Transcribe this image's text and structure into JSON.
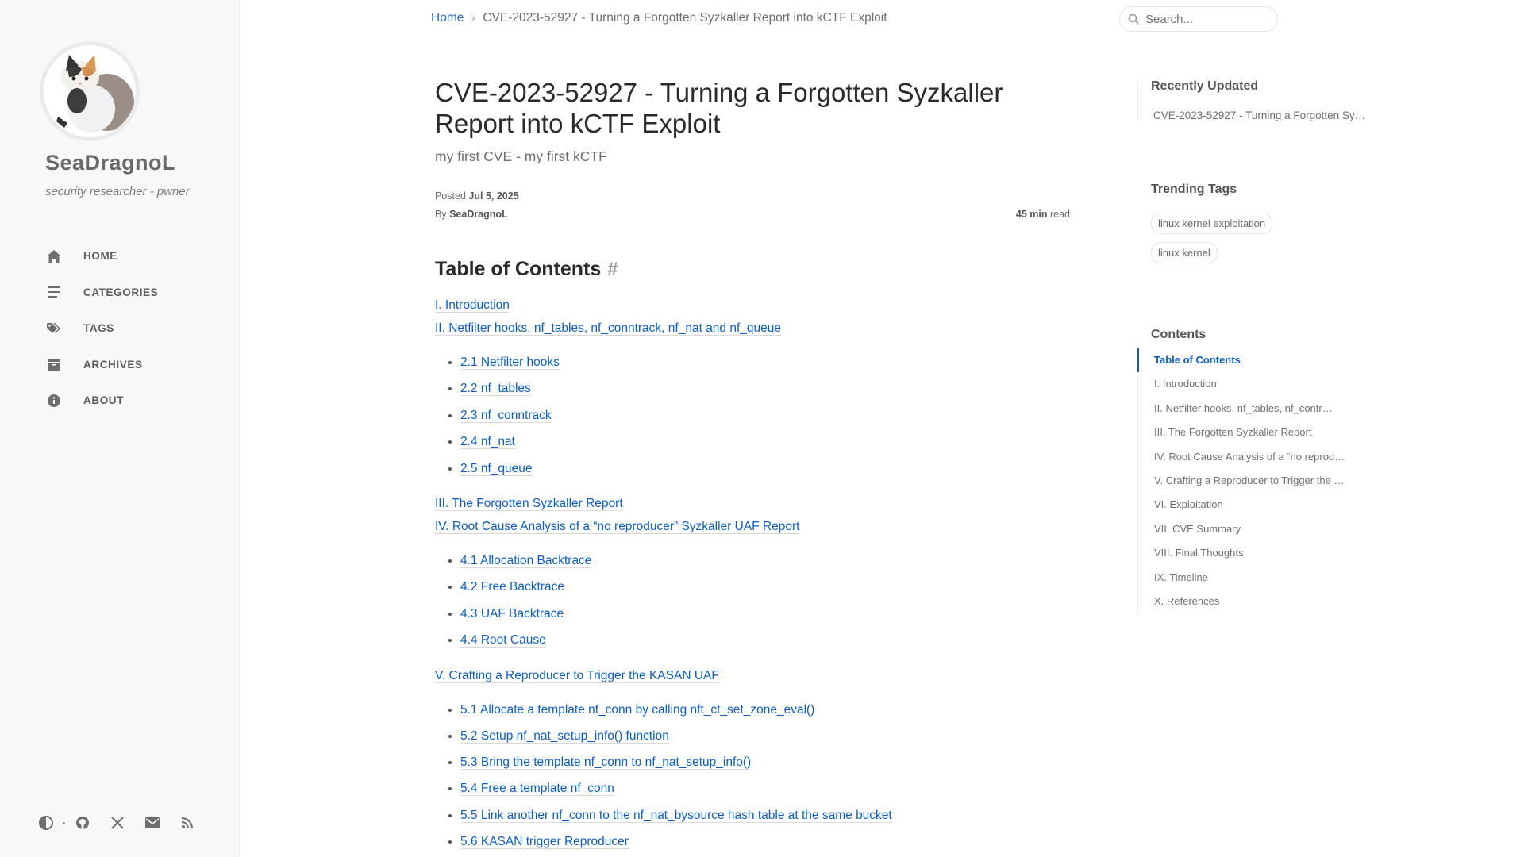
{
  "sidebar": {
    "site_title": "SeaDragnoL",
    "site_subtitle": "security researcher - pwner",
    "nav": [
      {
        "label": "HOME",
        "icon": "home-icon"
      },
      {
        "label": "CATEGORIES",
        "icon": "list-icon"
      },
      {
        "label": "TAGS",
        "icon": "tags-icon"
      },
      {
        "label": "ARCHIVES",
        "icon": "archive-icon"
      },
      {
        "label": "ABOUT",
        "icon": "info-icon"
      }
    ],
    "bottom_icons": [
      "theme-toggle-icon",
      "github-icon",
      "x-twitter-icon",
      "email-icon",
      "rss-icon"
    ]
  },
  "topbar": {
    "breadcrumb_home": "Home",
    "breadcrumb_current": "CVE-2023-52927 - Turning a Forgotten Syzkaller Report into kCTF Exploit",
    "search_placeholder": "Search..."
  },
  "post": {
    "title": "CVE-2023-52927 - Turning a Forgotten Syzkaller Report into kCTF Exploit",
    "subtitle": "my first CVE - my first kCTF",
    "posted_label": "Posted",
    "posted_date": "Jul 5, 2025",
    "by_label": "By",
    "author": "SeaDragnoL",
    "read_time": "45 min",
    "read_label": "read"
  },
  "toc": {
    "heading": "Table of Contents",
    "hash": "#",
    "sections": [
      {
        "title": "I. Introduction",
        "subs": []
      },
      {
        "title": "II. Netfilter hooks, nf_tables, nf_conntrack, nf_nat and nf_queue",
        "subs": [
          "2.1 Netfilter hooks",
          "2.2 nf_tables",
          "2.3 nf_conntrack",
          "2.4 nf_nat",
          "2.5 nf_queue"
        ]
      },
      {
        "title": "III. The Forgotten Syzkaller Report",
        "subs": []
      },
      {
        "title": "IV. Root Cause Analysis of a “no reproducer” Syzkaller UAF Report",
        "subs": [
          "4.1 Allocation Backtrace",
          "4.2 Free Backtrace",
          "4.3 UAF Backtrace",
          "4.4 Root Cause"
        ]
      },
      {
        "title": "V. Crafting a Reproducer to Trigger the KASAN UAF",
        "subs": [
          "5.1 Allocate a template nf_conn by calling nft_ct_set_zone_eval()",
          "5.2 Setup nf_nat_setup_info() function",
          "5.3 Bring the template nf_conn to nf_nat_setup_info()",
          "5.4 Free a template nf_conn",
          "5.5 Link another nf_conn to the nf_nat_bysource hash table at the same bucket",
          "5.6 KASAN trigger Reproducer"
        ]
      }
    ]
  },
  "right_panel": {
    "recent_title": "Recently Updated",
    "recent_items": [
      "CVE-2023-52927 - Turning a Forgotten Sy…"
    ],
    "tags_title": "Trending Tags",
    "tags": [
      "linux kernel exploitation",
      "linux kernel"
    ],
    "contents_title": "Contents",
    "contents": [
      "Table of Contents",
      "I. Introduction",
      "II. Netfilter hooks, nf_tables, nf_contr…",
      "III. The Forgotten Syzkaller Report",
      "IV. Root Cause Analysis of a “no reprod…",
      "V. Crafting a Reproducer to Trigger the …",
      "VI. Exploitation",
      "VII. CVE Summary",
      "VIII. Final Thoughts",
      "IX. Timeline",
      "X. References"
    ]
  },
  "colors": {
    "link": "#0b5fc4",
    "sidebar_bg": "#f6f8fa"
  }
}
